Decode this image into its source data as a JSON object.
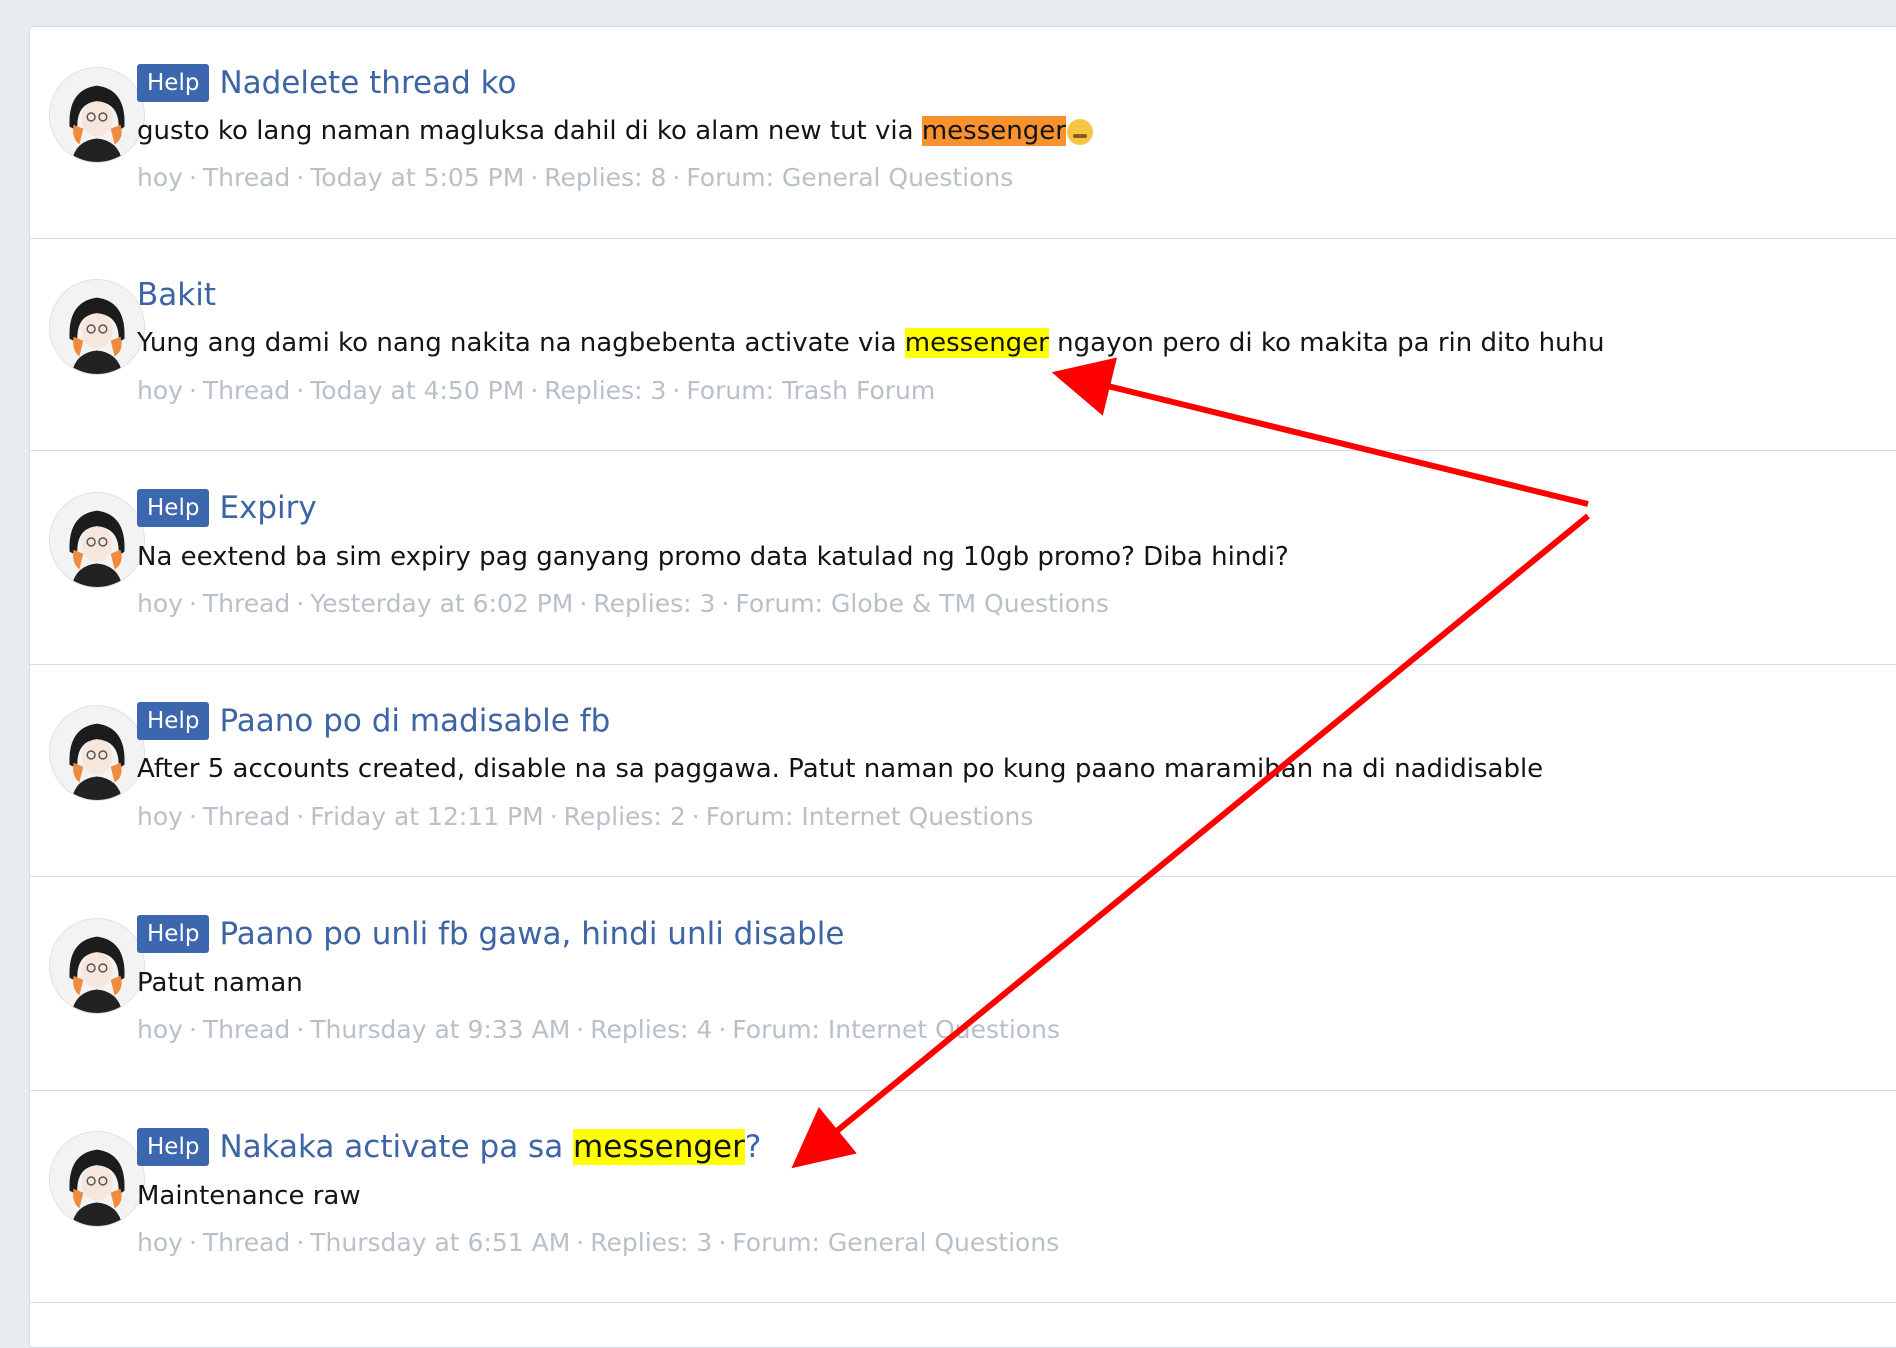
{
  "results": [
    {
      "prefix": "Help",
      "title": "Nadelete thread ko",
      "title_highlight": "",
      "title_after": "",
      "snippet_before": "gusto ko lang naman magluksa dahil di ko alam new tut via ",
      "snippet_highlight": "messenger",
      "snippet_after": "",
      "snippet_emoji": "🥺",
      "meta": {
        "user": "hoy",
        "type": "Thread",
        "date": "Today at 5:05 PM",
        "replies": "Replies: 8",
        "forum": "Forum: General Questions"
      }
    },
    {
      "prefix": "",
      "title": "Bakit",
      "title_highlight": "",
      "title_after": "",
      "snippet_before": "Yung ang dami ko nang nakita na nagbebenta activate via ",
      "snippet_highlight": "messenger",
      "snippet_after": " ngayon pero di ko makita pa rin dito huhu",
      "snippet_emoji": "",
      "meta": {
        "user": "hoy",
        "type": "Thread",
        "date": "Today at 4:50 PM",
        "replies": "Replies: 3",
        "forum": "Forum: Trash Forum"
      }
    },
    {
      "prefix": "Help",
      "title": "Expiry",
      "title_highlight": "",
      "title_after": "",
      "snippet_before": "Na eextend ba sim expiry pag ganyang promo data katulad ng 10gb promo? Diba hindi?",
      "snippet_highlight": "",
      "snippet_after": "",
      "snippet_emoji": "",
      "meta": {
        "user": "hoy",
        "type": "Thread",
        "date": "Yesterday at 6:02 PM",
        "replies": "Replies: 3",
        "forum": "Forum: Globe & TM Questions"
      }
    },
    {
      "prefix": "Help",
      "title": "Paano po di madisable fb",
      "title_highlight": "",
      "title_after": "",
      "snippet_before": "After 5 accounts created, disable na sa paggawa. Patut naman po kung paano maramihan na di nadidisable",
      "snippet_highlight": "",
      "snippet_after": "",
      "snippet_emoji": "",
      "meta": {
        "user": "hoy",
        "type": "Thread",
        "date": "Friday at 12:11 PM",
        "replies": "Replies: 2",
        "forum": "Forum: Internet Questions"
      }
    },
    {
      "prefix": "Help",
      "title": "Paano po unli fb gawa, hindi unli disable",
      "title_highlight": "",
      "title_after": "",
      "snippet_before": "Patut naman",
      "snippet_highlight": "",
      "snippet_after": "",
      "snippet_emoji": "",
      "meta": {
        "user": "hoy",
        "type": "Thread",
        "date": "Thursday at 9:33 AM",
        "replies": "Replies: 4",
        "forum": "Forum: Internet Questions"
      }
    },
    {
      "prefix": "Help",
      "title": "Nakaka activate pa sa ",
      "title_highlight": "messenger",
      "title_after": "?",
      "snippet_before": "Maintenance raw",
      "snippet_highlight": "",
      "snippet_after": "",
      "snippet_emoji": "",
      "meta": {
        "user": "hoy",
        "type": "Thread",
        "date": "Thursday at 6:51 AM",
        "replies": "Replies: 3",
        "forum": "Forum: General Questions"
      }
    }
  ],
  "meta_separator": "·",
  "colors": {
    "page_bg": "#e9ecef",
    "panel_bg": "#ffffff",
    "prefix_bg": "#3c66ad",
    "title_link": "#3d64a5",
    "meta_text": "#b9c0c8",
    "highlight": "#ffff00",
    "highlight_current": "#f7922f",
    "annotation_arrow": "#ff0000"
  }
}
